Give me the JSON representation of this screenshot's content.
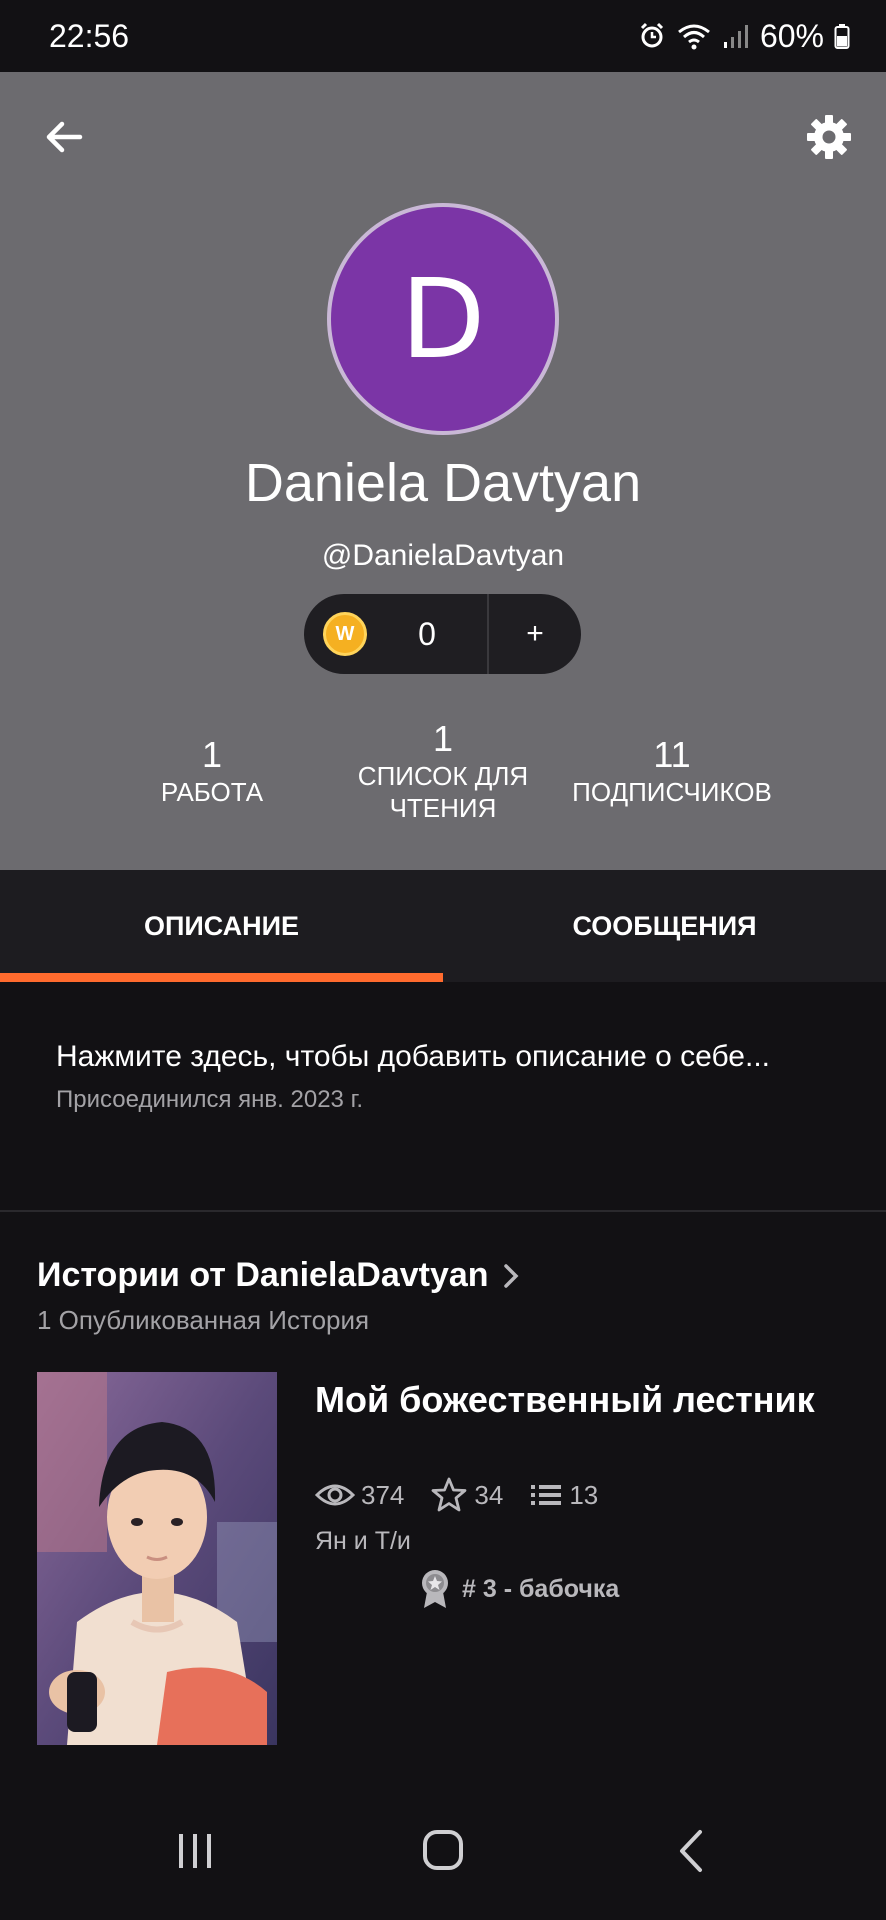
{
  "status_bar": {
    "time": "22:56",
    "battery": "60%"
  },
  "profile": {
    "avatar_letter": "D",
    "display_name": "Daniela Davtyan",
    "username": "@DanielaDavtyan",
    "coins": "0",
    "coin_add": "+"
  },
  "stats": [
    {
      "value": "1",
      "label": "РАБОТА"
    },
    {
      "value": "1",
      "label": "СПИСОК ДЛЯ ЧТЕНИЯ"
    },
    {
      "value": "11",
      "label": "ПОДПИСЧИКОВ"
    }
  ],
  "tabs": [
    {
      "label": "ОПИСАНИЕ",
      "active": true
    },
    {
      "label": "СООБЩЕНИЯ",
      "active": false
    }
  ],
  "about": {
    "description_placeholder": "Нажмите здесь, чтобы добавить описание о себе...",
    "joined": "Присоединился янв. 2023 г."
  },
  "stories": {
    "title": "Истории от DanielaDavtyan",
    "subtitle": "1 Опубликованная История",
    "items": [
      {
        "title": "Мой божественный лестник",
        "reads": "374",
        "votes": "34",
        "parts": "13",
        "tags": "Ян и Т/и",
        "rank": "# 3 - бабочка"
      }
    ]
  },
  "colors": {
    "header_bg": "#6c6b6f",
    "avatar_bg": "#7b35a6",
    "accent": "#ff6b2e",
    "page_bg": "#121114",
    "tab_bg": "#1d1c20"
  }
}
